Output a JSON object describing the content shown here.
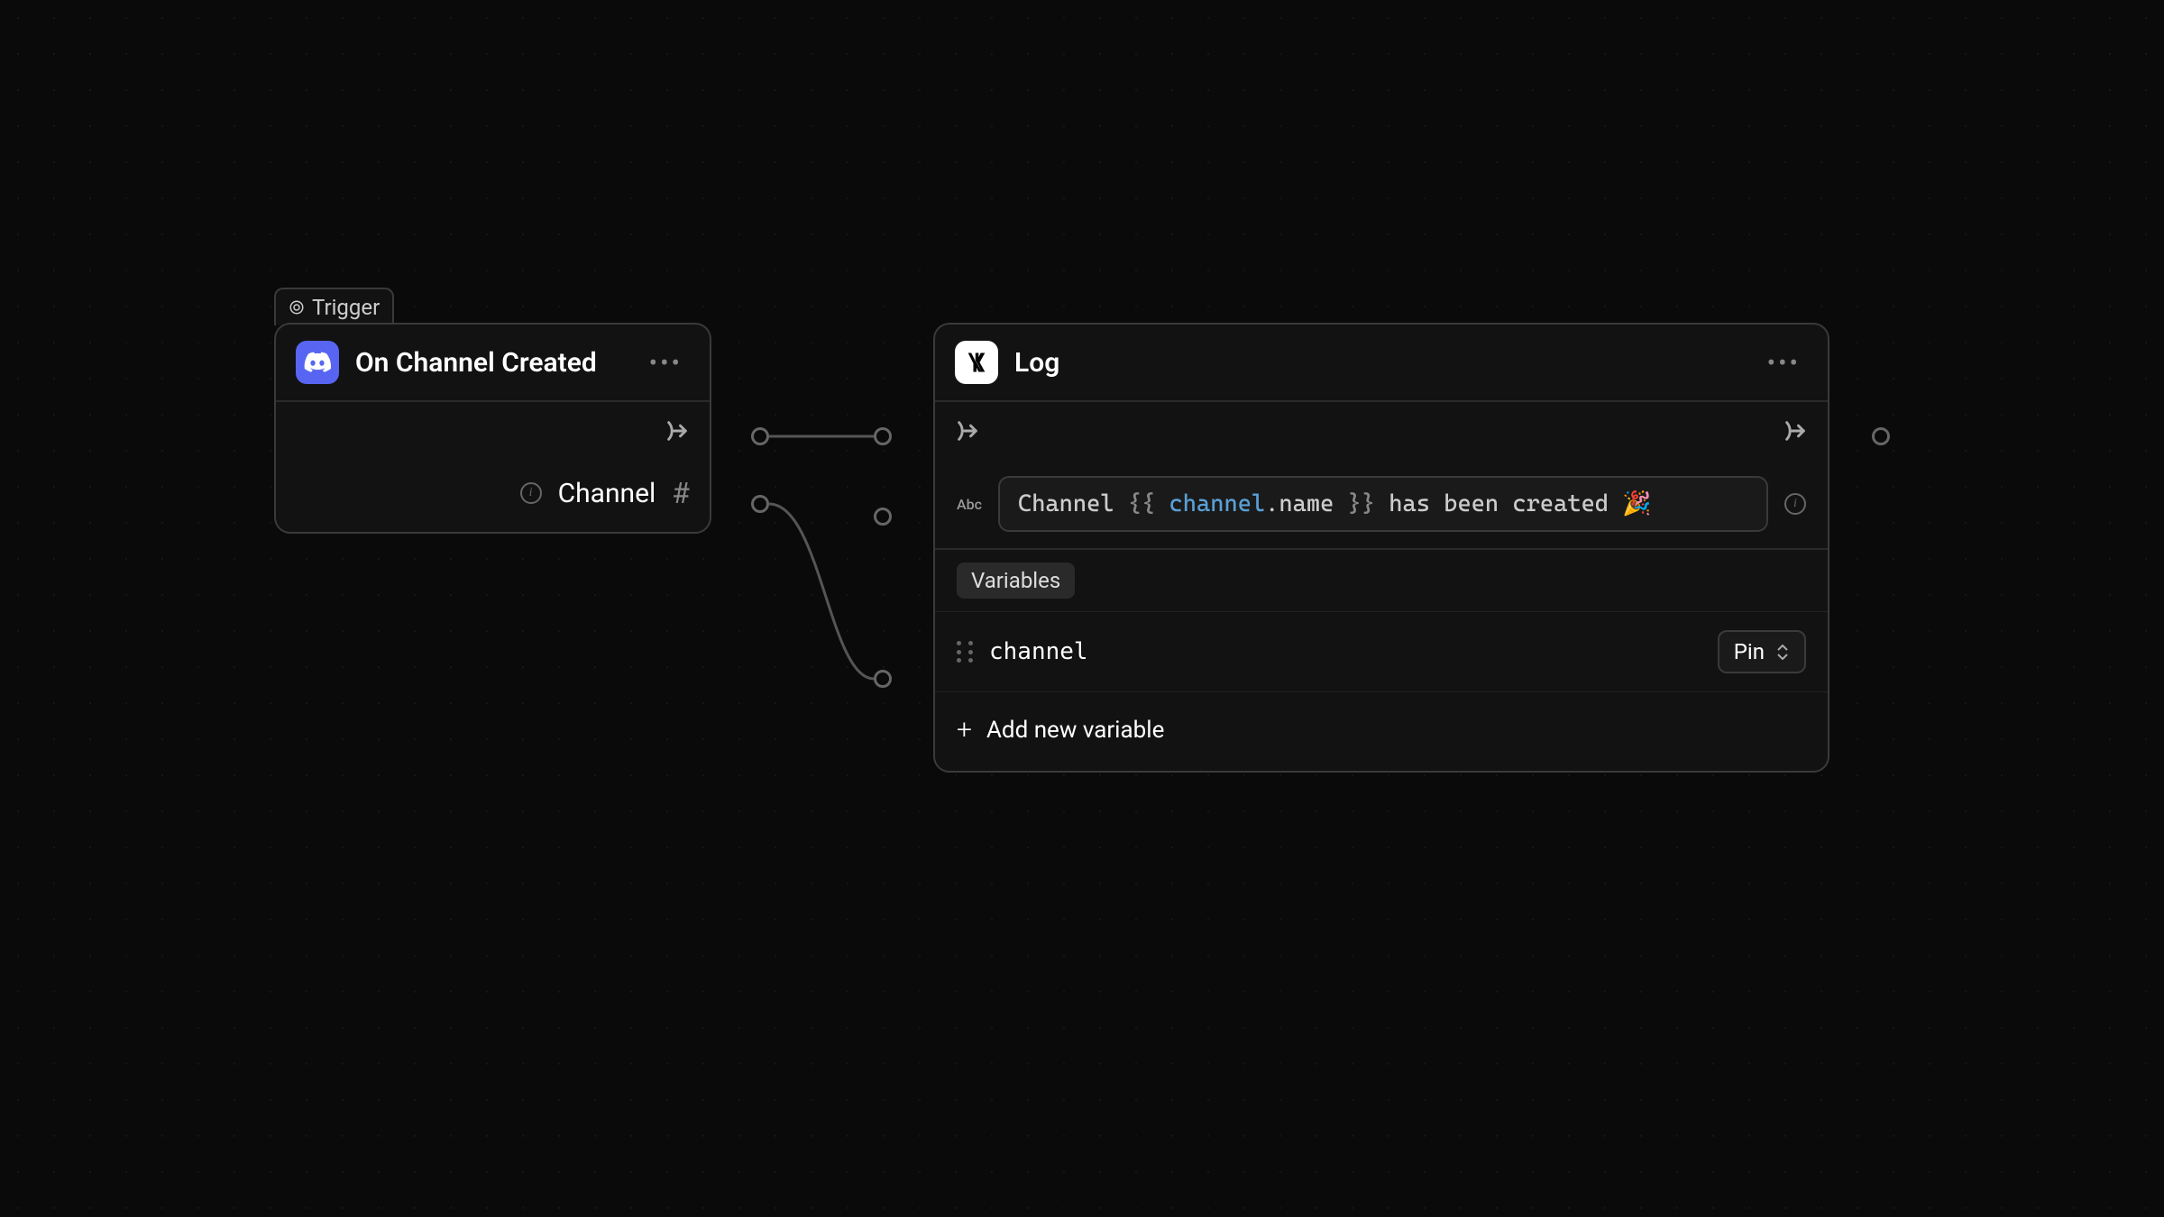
{
  "canvas": {
    "trigger_badge": "Trigger"
  },
  "nodes": {
    "trigger": {
      "title": "On Channel Created",
      "output_label": "Channel"
    },
    "log": {
      "title": "Log",
      "input_type_label": "Abc",
      "template": {
        "prefix": "Channel ",
        "brace_open": "{{ ",
        "var": "channel",
        "dot": ".",
        "prop": "name",
        "brace_close": " }}",
        "suffix": " has been created 🎉"
      },
      "variables_header": "Variables",
      "variables": [
        {
          "name": "channel",
          "mode": "Pin"
        }
      ],
      "add_variable_label": "Add new variable"
    }
  }
}
